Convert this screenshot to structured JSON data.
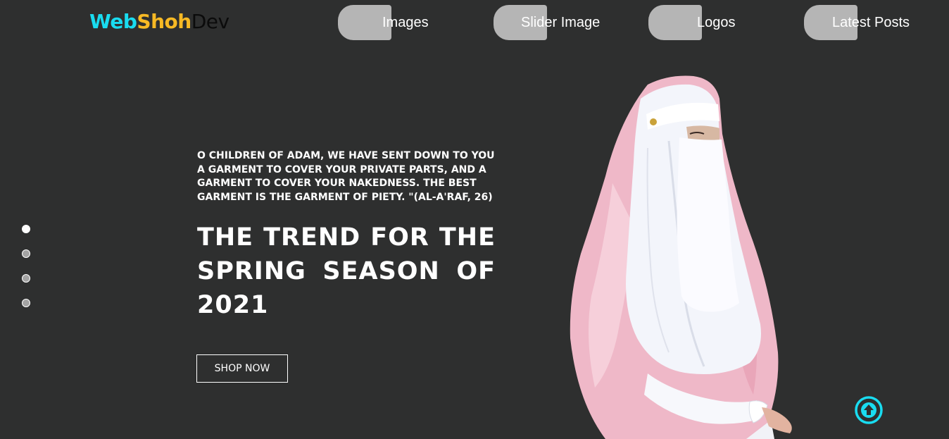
{
  "brand": {
    "part1": "Web",
    "part2": "Shoh",
    "part3": "Dev"
  },
  "nav": {
    "items": [
      {
        "label": "Images"
      },
      {
        "label": "Slider Image"
      },
      {
        "label": "Logos"
      },
      {
        "label": "Latest Posts"
      }
    ]
  },
  "slider": {
    "dots": 4,
    "active_index": 0
  },
  "hero": {
    "quote": "O children of Adam, We have sent down to you a garment to cover your private parts, and a garment to cover your nakedness. The best garment is the garment of piety. \"(Al-A'raf, 26)",
    "headline": "THE TREND FOR THE SPRING SEASON OF 2021",
    "cta_label": "SHOP NOW"
  },
  "colors": {
    "background": "#2e2f2f",
    "brand_cyan": "#19dcf0",
    "brand_yellow": "#f7b924",
    "nav_pill": "#b5b5b5",
    "scroll_top": "#19dcf0"
  },
  "icons": {
    "scroll_top": "arrow-up-circle-icon"
  }
}
